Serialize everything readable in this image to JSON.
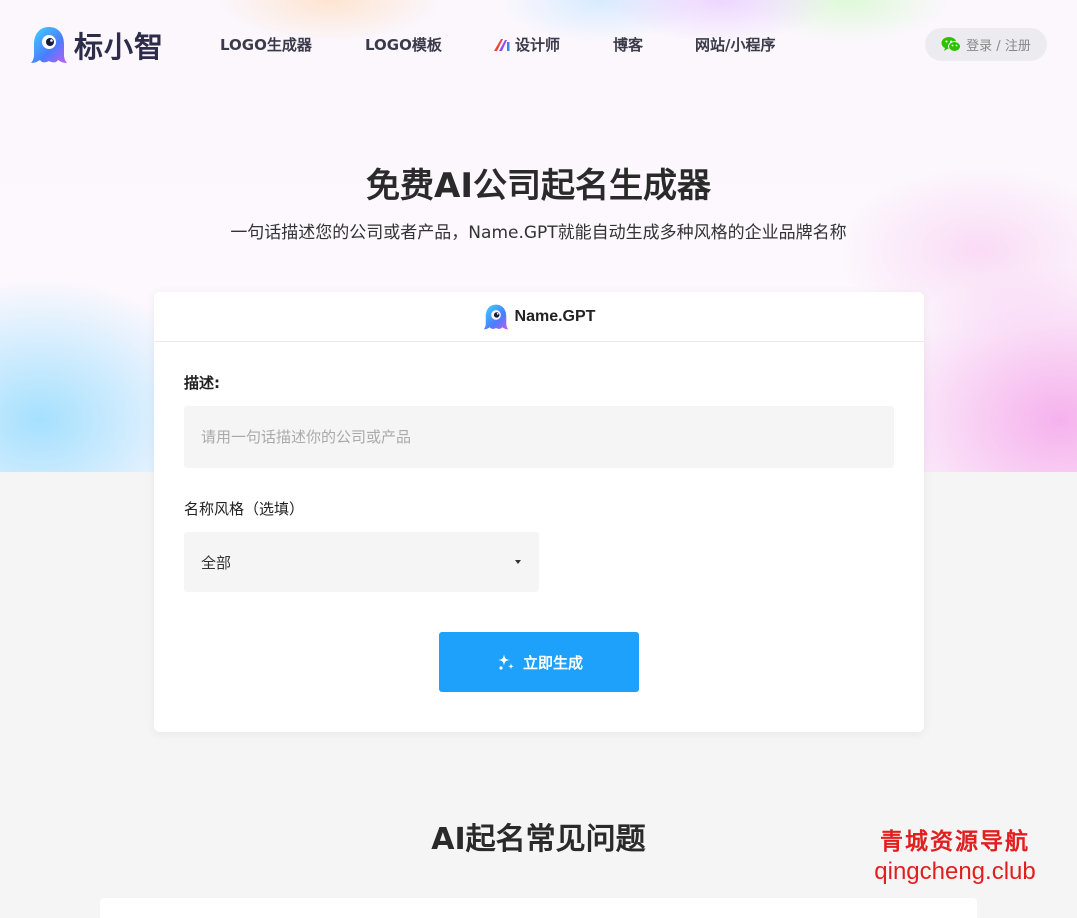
{
  "brand": {
    "name": "标小智"
  },
  "nav": {
    "items": [
      {
        "label": "LOGO生成器"
      },
      {
        "label": "LOGO模板"
      },
      {
        "label": "设计师"
      },
      {
        "label": "博客"
      },
      {
        "label": "网站/小程序"
      }
    ],
    "login_label": "登录 / 注册"
  },
  "hero": {
    "title": "免费AI公司起名生成器",
    "subtitle": "一句话描述您的公司或者产品，Name.GPT就能自动生成多种风格的企业品牌名称"
  },
  "card": {
    "title": "Name.GPT",
    "description_label": "描述:",
    "description_placeholder": "请用一句话描述你的公司或产品",
    "description_value": "",
    "style_label": "名称风格（选填）",
    "style_selected": "全部",
    "generate_label": "立即生成"
  },
  "faq": {
    "title": "AI起名常见问题"
  },
  "watermark": {
    "line1": "青城资源导航",
    "line2": "qingcheng.club"
  },
  "colors": {
    "primary": "#1ea1fa",
    "watermark": "#e11f1f",
    "background": "#f5f5f5"
  },
  "icons": [
    "mascot-logo-icon",
    "ai-mark-icon",
    "wechat-icon",
    "caret-down-icon",
    "sparkle-icon"
  ]
}
